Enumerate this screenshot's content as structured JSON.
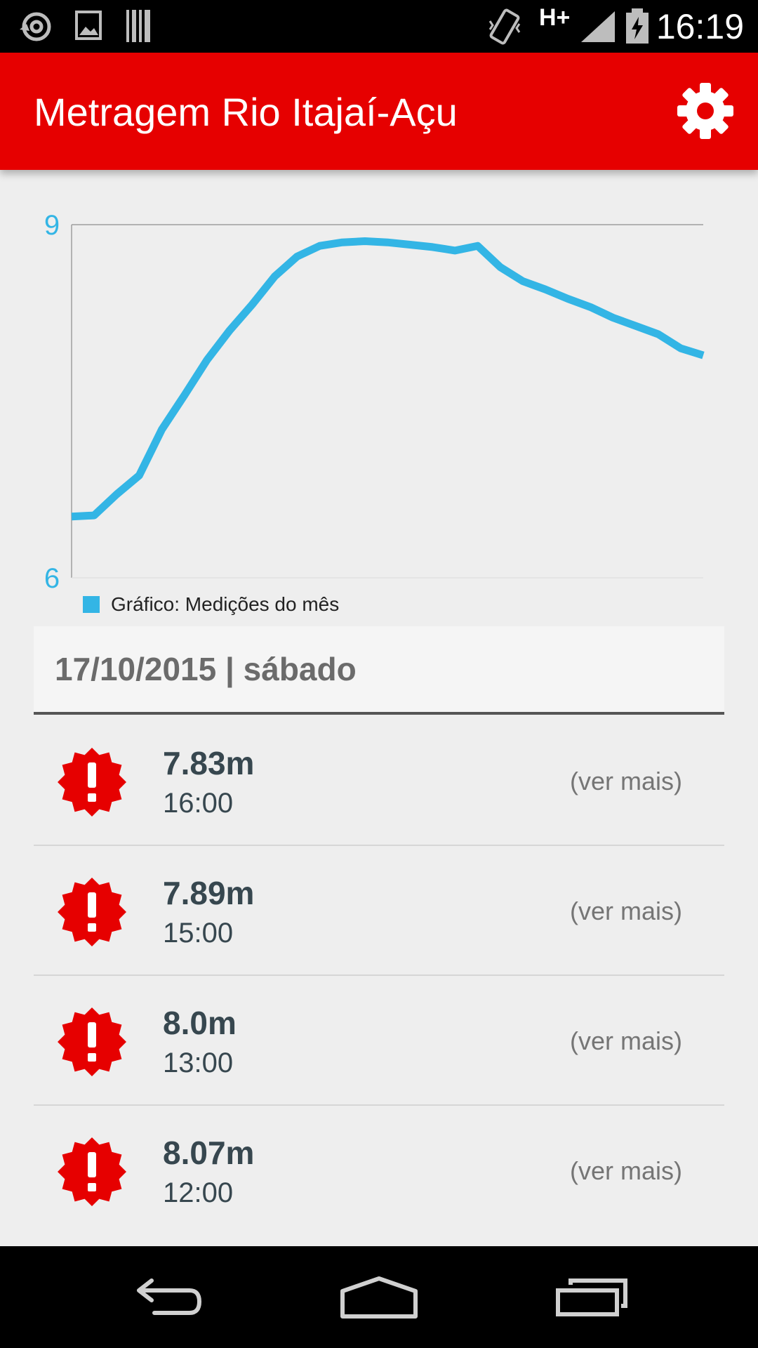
{
  "status_bar": {
    "time": "16:19",
    "network": "H+",
    "icons": [
      "sync-icon",
      "image-icon",
      "barcode-icon",
      "vibrate-icon",
      "signal-icon",
      "battery-charging-icon"
    ]
  },
  "app_bar": {
    "title": "Metragem Rio Itajaí-Açu",
    "settings_icon": "gear-icon"
  },
  "colors": {
    "accent": "#e60000",
    "chart_line": "#33b5e5",
    "text_dark": "#37474f",
    "text_muted": "#757575"
  },
  "chart_data": {
    "type": "line",
    "title": "",
    "xlabel": "",
    "ylabel": "",
    "ylim": [
      6,
      9
    ],
    "ytick_labels": [
      "9",
      "6"
    ],
    "grid": false,
    "legend": {
      "placement": "bottom-left",
      "label": "Gráfico: Medições do mês"
    },
    "x": [
      1,
      2,
      3,
      4,
      5,
      6,
      7,
      8,
      9,
      10,
      11,
      12,
      13,
      14,
      15,
      16,
      17,
      18,
      19,
      20,
      21,
      22,
      23,
      24,
      25,
      26,
      27,
      28,
      29
    ],
    "series": [
      {
        "name": "Gráfico: Medições do mês",
        "color": "#33b5e5",
        "values": [
          6.52,
          6.53,
          6.71,
          6.87,
          7.26,
          7.55,
          7.85,
          8.1,
          8.32,
          8.56,
          8.73,
          8.82,
          8.85,
          8.86,
          8.85,
          8.83,
          8.81,
          8.78,
          8.82,
          8.64,
          8.52,
          8.45,
          8.37,
          8.3,
          8.21,
          8.14,
          8.07,
          7.95,
          7.89
        ]
      }
    ]
  },
  "date_header": "17/10/2015 | sábado",
  "readings": [
    {
      "value": "7.83m",
      "time": "16:00",
      "more": "(ver mais)",
      "icon": "alert-badge-icon"
    },
    {
      "value": "7.89m",
      "time": "15:00",
      "more": "(ver mais)",
      "icon": "alert-badge-icon"
    },
    {
      "value": "8.0m",
      "time": "13:00",
      "more": "(ver mais)",
      "icon": "alert-badge-icon"
    },
    {
      "value": "8.07m",
      "time": "12:00",
      "more": "(ver mais)",
      "icon": "alert-badge-icon"
    }
  ],
  "nav_bar": {
    "back_icon": "back-icon",
    "home_icon": "home-icon",
    "recents_icon": "recents-icon"
  }
}
